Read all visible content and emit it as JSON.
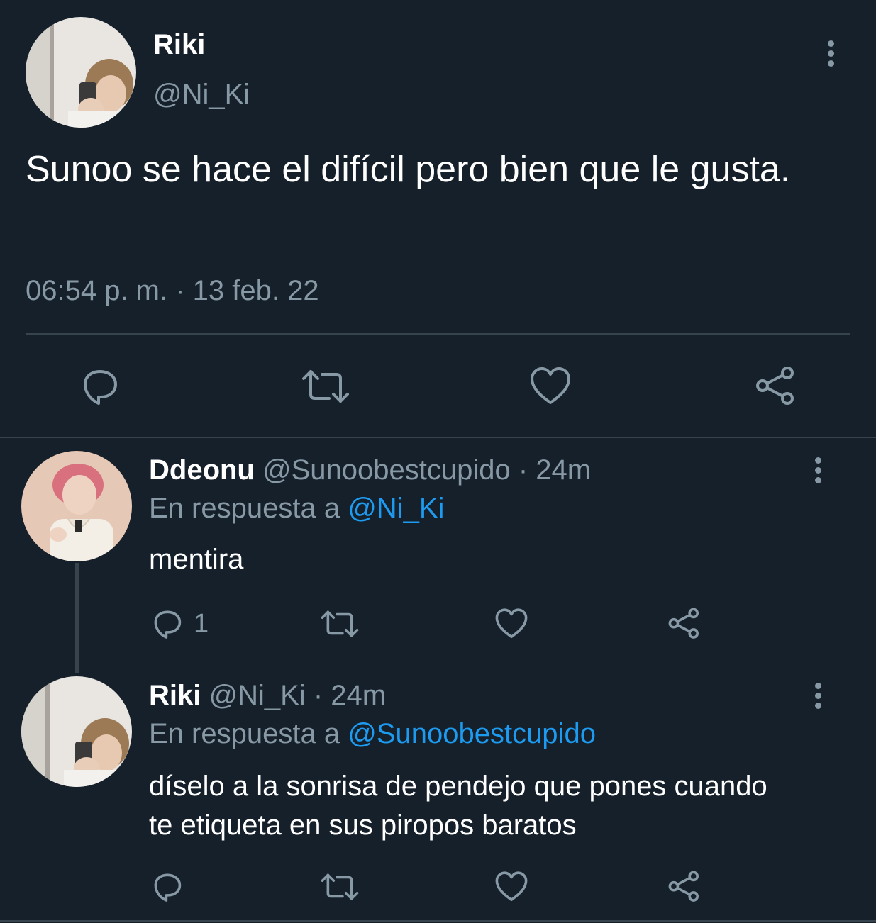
{
  "main_tweet": {
    "author_name": "Riki",
    "author_handle": "@Ni_Ki",
    "text": "Sunoo se hace el difícil pero bien que le gusta.",
    "timestamp": "06:54 p. m. · 13 feb. 22"
  },
  "replies": [
    {
      "author_name": "Ddeonu",
      "author_handle": "@Sunoobestcupido",
      "time": "· 24m",
      "reply_prefix": "En respuesta a",
      "reply_to": "@Ni_Ki",
      "text": "mentira",
      "reply_count": "1"
    },
    {
      "author_name": "Riki",
      "author_handle": "@Ni_Ki",
      "time": "· 24m",
      "reply_prefix": "En respuesta a",
      "reply_to": "@Sunoobestcupido",
      "text": "díselo a la sonrisa de pendejo que pones cuando te etiqueta en sus piropos baratos",
      "reply_count": ""
    }
  ],
  "icons": {
    "reply": "reply-icon",
    "retweet": "retweet-icon",
    "like": "heart-icon",
    "share": "share-icon",
    "more": "more-vertical-icon"
  },
  "colors": {
    "background": "#15202b",
    "text": "#ffffff",
    "muted": "#8899a6",
    "link": "#1d9bf0",
    "divider": "#38444d"
  }
}
